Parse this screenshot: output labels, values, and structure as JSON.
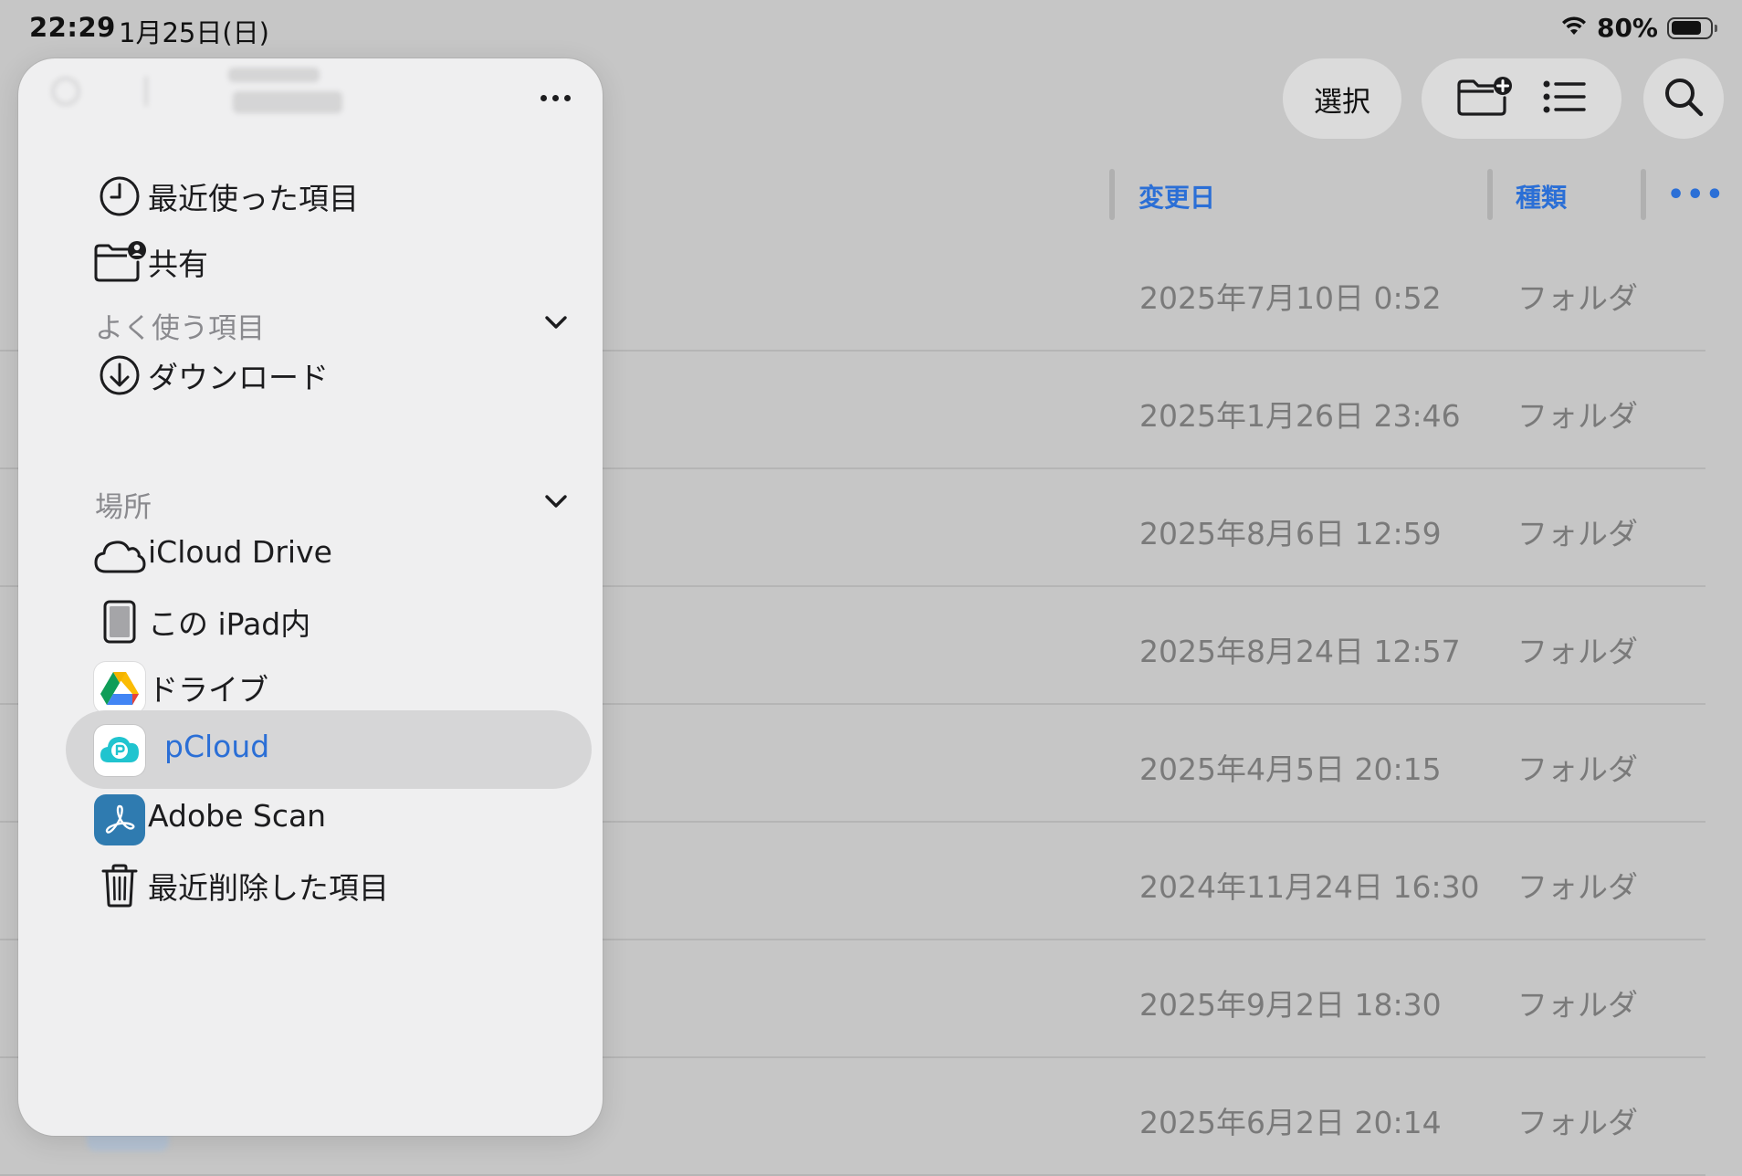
{
  "status_bar": {
    "time": "22:29",
    "date": "1月25日(日)",
    "battery_percent": "80%",
    "battery_level": 0.8
  },
  "toolbar": {
    "select_label": "選択"
  },
  "columns": {
    "modified": "変更日",
    "kind": "種類"
  },
  "files": [
    {
      "date": "2025年7月10日 0:52",
      "kind": "フォルダ"
    },
    {
      "date": "2025年1月26日 23:46",
      "kind": "フォルダ"
    },
    {
      "date": "2025年8月6日 12:59",
      "kind": "フォルダ"
    },
    {
      "date": "2025年8月24日 12:57",
      "kind": "フォルダ"
    },
    {
      "date": "2025年4月5日 20:15",
      "kind": "フォルダ"
    },
    {
      "date": "2024年11月24日 16:30",
      "kind": "フォルダ"
    },
    {
      "date": "2025年9月2日 18:30",
      "kind": "フォルダ"
    },
    {
      "date": "2025年6月2日 20:14",
      "kind": "フォルダ"
    }
  ],
  "sidebar": {
    "top_items": [
      {
        "label": "最近使った項目",
        "icon": "clock-icon"
      },
      {
        "label": "共有",
        "icon": "shared-folder-icon"
      }
    ],
    "favorites": {
      "title": "よく使う項目",
      "items": [
        {
          "label": "ダウンロード",
          "icon": "download-icon"
        }
      ]
    },
    "locations": {
      "title": "場所",
      "items": [
        {
          "label": "iCloud Drive",
          "icon": "cloud-icon"
        },
        {
          "label": "この iPad内",
          "icon": "ipad-icon"
        },
        {
          "label": "ドライブ",
          "icon": "google-drive-icon"
        },
        {
          "label": "pCloud",
          "icon": "pcloud-icon",
          "selected": true
        },
        {
          "label": "Adobe Scan",
          "icon": "adobe-scan-icon"
        },
        {
          "label": "最近削除した項目",
          "icon": "trash-icon"
        }
      ]
    }
  },
  "colors": {
    "accent": "#2b6fd6",
    "secondary_text": "#7a7a7a",
    "sidebar_bg": "#efeff0",
    "selection_bg": "#d6d6d7"
  }
}
